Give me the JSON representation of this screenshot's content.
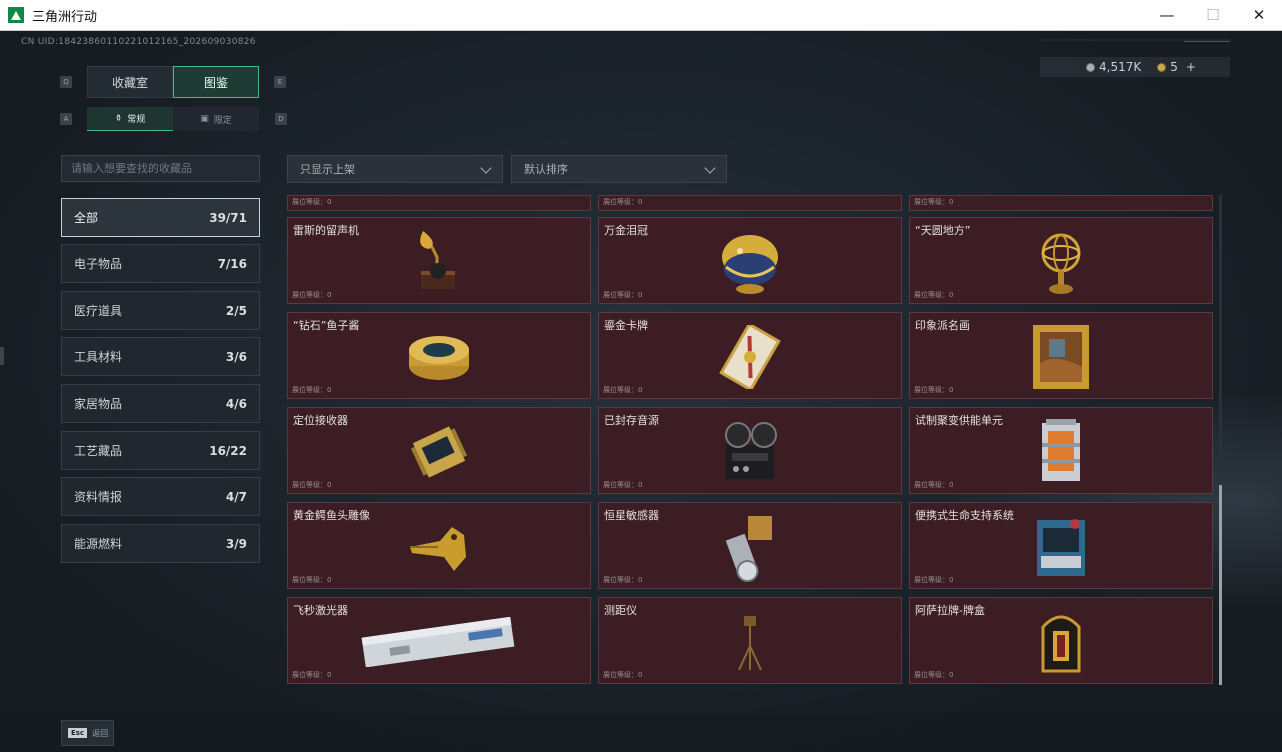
{
  "window": {
    "title": "三角洲行动",
    "controls": {
      "minimize": "—",
      "maximize": "☐",
      "close": "✕"
    }
  },
  "header": {
    "uid": "CN UID:18423860110221012165_202609030826"
  },
  "currency": {
    "silver": "4,517K",
    "gold": "5",
    "add": "+"
  },
  "keys": {
    "q": "Q",
    "e": "E",
    "a": "A",
    "d": "D"
  },
  "main_tabs": [
    {
      "label": "收藏室",
      "active": false
    },
    {
      "label": "图鉴",
      "active": true
    }
  ],
  "sub_tabs": [
    {
      "label": "常规",
      "icon": "flask-icon",
      "glyph": "⚱",
      "active": true
    },
    {
      "label": "限定",
      "icon": "frame-icon",
      "glyph": "▣",
      "active": false
    }
  ],
  "search": {
    "placeholder": "请输入想要查找的收藏品"
  },
  "filters": {
    "shelf_filter": "只显示上架",
    "sort": "默认排序"
  },
  "categories": [
    {
      "label": "全部",
      "count": "39/71",
      "active": true
    },
    {
      "label": "电子物品",
      "count": "7/16"
    },
    {
      "label": "医疗道具",
      "count": "2/5"
    },
    {
      "label": "工具材料",
      "count": "3/6"
    },
    {
      "label": "家居物品",
      "count": "4/6"
    },
    {
      "label": "工艺藏品",
      "count": "16/22"
    },
    {
      "label": "资料情报",
      "count": "4/7"
    },
    {
      "label": "能源燃料",
      "count": "3/9"
    }
  ],
  "level_label": "展位等级：0",
  "items": [
    {
      "name": "雷斯的留声机",
      "icon": "gramophone-icon"
    },
    {
      "name": "万金泪冠",
      "icon": "jeweled-egg-icon"
    },
    {
      "name": "“天圆地方”",
      "icon": "armillary-sphere-icon"
    },
    {
      "name": "“钻石”鱼子酱",
      "icon": "caviar-tin-icon"
    },
    {
      "name": "鎏金卡牌",
      "icon": "gilded-card-icon"
    },
    {
      "name": "印象派名画",
      "icon": "framed-painting-icon"
    },
    {
      "name": "定位接收器",
      "icon": "locator-receiver-icon"
    },
    {
      "name": "已封存音源",
      "icon": "reel-tape-recorder-icon"
    },
    {
      "name": "试制聚变供能单元",
      "icon": "fusion-cell-icon"
    },
    {
      "name": "黄金鳄鱼头雕像",
      "icon": "gold-crocodile-statue-icon"
    },
    {
      "name": "恒星敏感器",
      "icon": "star-sensor-icon"
    },
    {
      "name": "便携式生命支持系统",
      "icon": "life-support-unit-icon"
    },
    {
      "name": "飞秒激光器",
      "icon": "femtosecond-laser-icon"
    },
    {
      "name": "测距仪",
      "icon": "rangefinder-tripod-icon"
    },
    {
      "name": "阿萨拉牌-牌盒",
      "icon": "card-box-icon"
    }
  ],
  "footer": {
    "esc_key": "Esc",
    "esc_label": "返回"
  },
  "colors": {
    "accent": "#3fb98a",
    "card_bg": "#3b1d23",
    "background": "#1b222a"
  }
}
